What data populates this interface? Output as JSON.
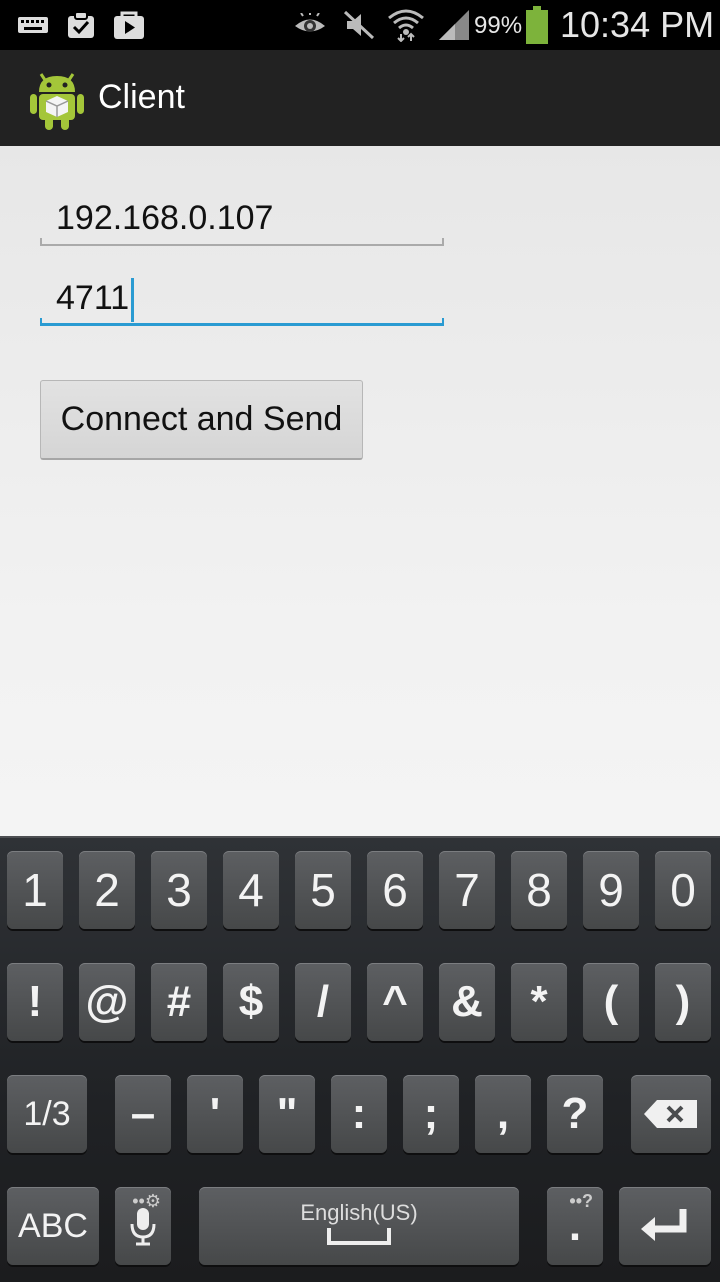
{
  "status_bar": {
    "battery_percent": "99%",
    "time": "10:34 PM",
    "icons": [
      "keyboard-icon",
      "clipboard-check-icon",
      "play-store-icon",
      "eye-icon",
      "mute-icon",
      "wifi-icon",
      "signal-icon",
      "battery-icon"
    ]
  },
  "action_bar": {
    "title": "Client"
  },
  "form": {
    "ip_value": "192.168.0.107",
    "port_value": "4711",
    "button_label": "Connect and Send"
  },
  "keyboard": {
    "row1": [
      "1",
      "2",
      "3",
      "4",
      "5",
      "6",
      "7",
      "8",
      "9",
      "0"
    ],
    "row2": [
      "!",
      "@",
      "#",
      "$",
      "/",
      "^",
      "&",
      "*",
      "(",
      ")"
    ],
    "row3": [
      "1/3",
      "–",
      "'",
      "\"",
      ":",
      ";",
      ",",
      "?"
    ],
    "abc_label": "ABC",
    "space_label": "English(US)",
    "period_label": ".",
    "mic_hint": "••⚙",
    "period_hint": "••?"
  },
  "colors": {
    "accent": "#2a9bd2",
    "android_green": "#a4c639"
  }
}
